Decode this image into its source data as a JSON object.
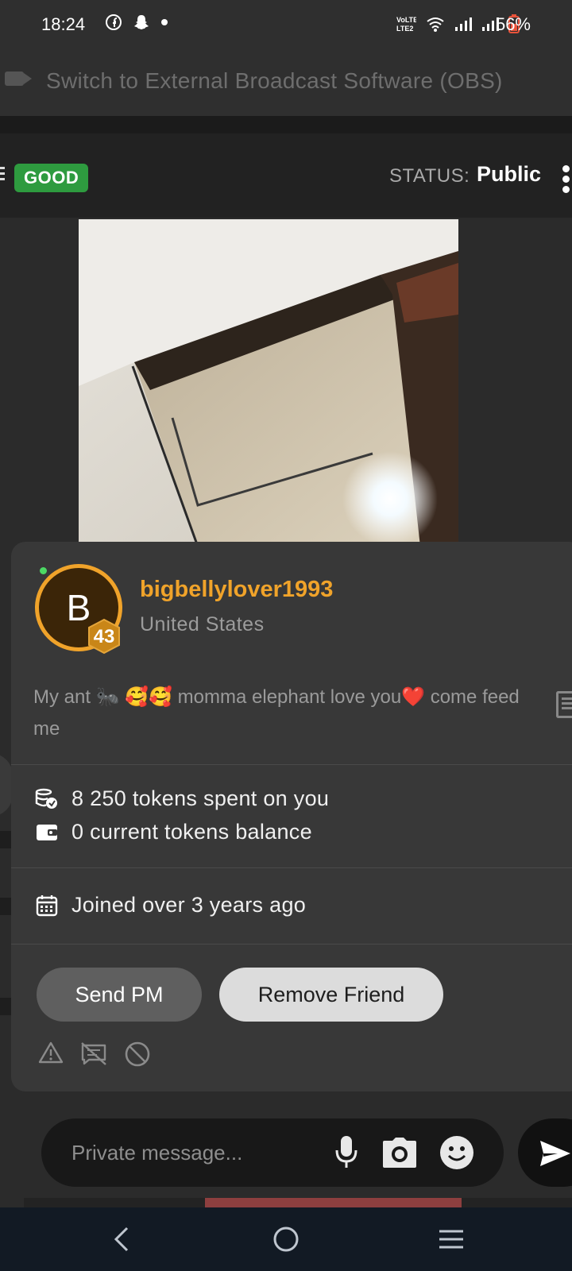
{
  "status_bar": {
    "time": "18:24",
    "battery_percent": "56%",
    "left_icons": [
      "facebook-icon",
      "snapchat-icon",
      "dot-icon"
    ],
    "right_icons": [
      "volte-icon",
      "wifi-icon",
      "signal-icon",
      "signal-icon",
      "battery-icon"
    ]
  },
  "obs_bar": {
    "label": "Switch to External Broadcast Software (OBS)",
    "icon": "video-camera-icon"
  },
  "header": {
    "quality_badge": "GOOD",
    "status_label": "STATUS:",
    "status_value": "Public",
    "colors": {
      "badge": "#2e9b3f"
    }
  },
  "profile": {
    "avatar_letter": "B",
    "level": "43",
    "username": "bigbellylover1993",
    "country": "United States",
    "bio": "My ant 🐜 🥰🥰 momma elephant love you❤️ come feed me",
    "online": true,
    "colors": {
      "username": "#f0a32a",
      "avatar_ring": "#f0a32a",
      "online": "#4cd964"
    }
  },
  "stats": {
    "tokens_spent": "8 250 tokens spent on you",
    "tokens_balance": "0 current tokens balance",
    "joined": "Joined over 3 years ago"
  },
  "actions": {
    "send_pm": "Send PM",
    "remove_friend": "Remove Friend",
    "icons": [
      "report-icon",
      "no-chat-icon",
      "block-icon"
    ]
  },
  "chat": {
    "placeholder": "Private message...",
    "icons": [
      "microphone-icon",
      "camera-icon",
      "emoji-icon",
      "send-icon"
    ]
  },
  "progress": {
    "fraction": 0.7
  },
  "nav": {
    "icons": [
      "back-icon",
      "home-icon",
      "recents-icon"
    ]
  }
}
